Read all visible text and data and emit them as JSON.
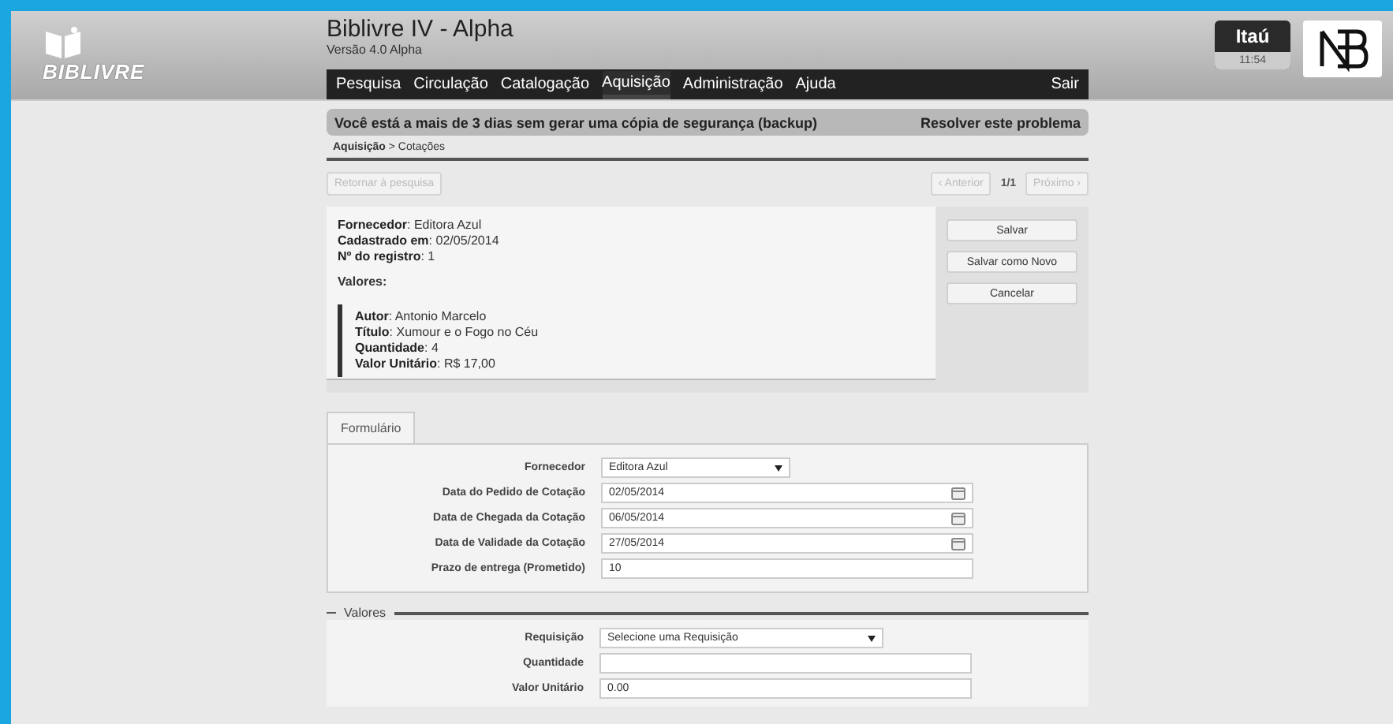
{
  "header": {
    "logo_text": "BIBLIVRE",
    "title": "Biblivre IV - Alpha",
    "version": "Versão 4.0 Alpha",
    "badge_name": "Itaú",
    "badge_time": "11:54"
  },
  "menu": [
    {
      "label": "Pesquisa",
      "selected": false
    },
    {
      "label": "Circulação",
      "selected": false
    },
    {
      "label": "Catalogação",
      "selected": false
    },
    {
      "label": "Aquisição",
      "selected": true
    },
    {
      "label": "Administração",
      "selected": false
    },
    {
      "label": "Ajuda",
      "selected": false
    }
  ],
  "logout": "Sair",
  "warning": {
    "message": "Você está a mais de 3 dias sem gerar uma cópia de segurança (backup)",
    "action": "Resolver este problema"
  },
  "breadcrumb": "**Aquisição** > Cotações",
  "navigation": {
    "back": {
      "label": "Retornar à pesquisa",
      "disabled": true
    },
    "previous": {
      "label": "‹ Anterior",
      "disabled": true
    },
    "position": "1/1",
    "next": {
      "label": "Próximo ›",
      "disabled": true
    }
  },
  "record": {
    "fields": [
      "**Fornecedor**: Editora Azul",
      "**Cadastrado em**: 02/05/2014",
      "**Nº do registro**: 1"
    ],
    "values_heading": "Valores:",
    "values": [
      "**Autor**: Antonio Marcelo",
      "**Título**: Xumour e o Fogo no Céu",
      "**Quantidade**: 4",
      "**Valor Unitário**: R$ 17,00"
    ],
    "actions": [
      "Salvar",
      "Salvar como Novo",
      "Cancelar"
    ]
  },
  "form": {
    "tab": {
      "label": "Formulário",
      "selected": true
    },
    "fields": [
      {
        "kind": "select",
        "label": "Fornecedor",
        "value": "Editora Azul"
      },
      {
        "kind": "date",
        "label": "Data do Pedido de Cotação",
        "value": "02/05/2014"
      },
      {
        "kind": "date",
        "label": "Data de Chegada da Cotação",
        "value": "06/05/2014"
      },
      {
        "kind": "date",
        "label": "Data de Validade da Cotação",
        "value": "27/05/2014"
      },
      {
        "kind": "text",
        "label": "Prazo de entrega (Prometido)",
        "value": "10"
      }
    ]
  },
  "values_section": {
    "legend": "Valores",
    "fields": [
      {
        "kind": "select",
        "label": "Requisição",
        "value": "Selecione uma Requisição"
      },
      {
        "kind": "text",
        "label": "Quantidade"
      },
      {
        "kind": "text",
        "label": "Valor Unitário",
        "value": "0.00"
      }
    ]
  }
}
